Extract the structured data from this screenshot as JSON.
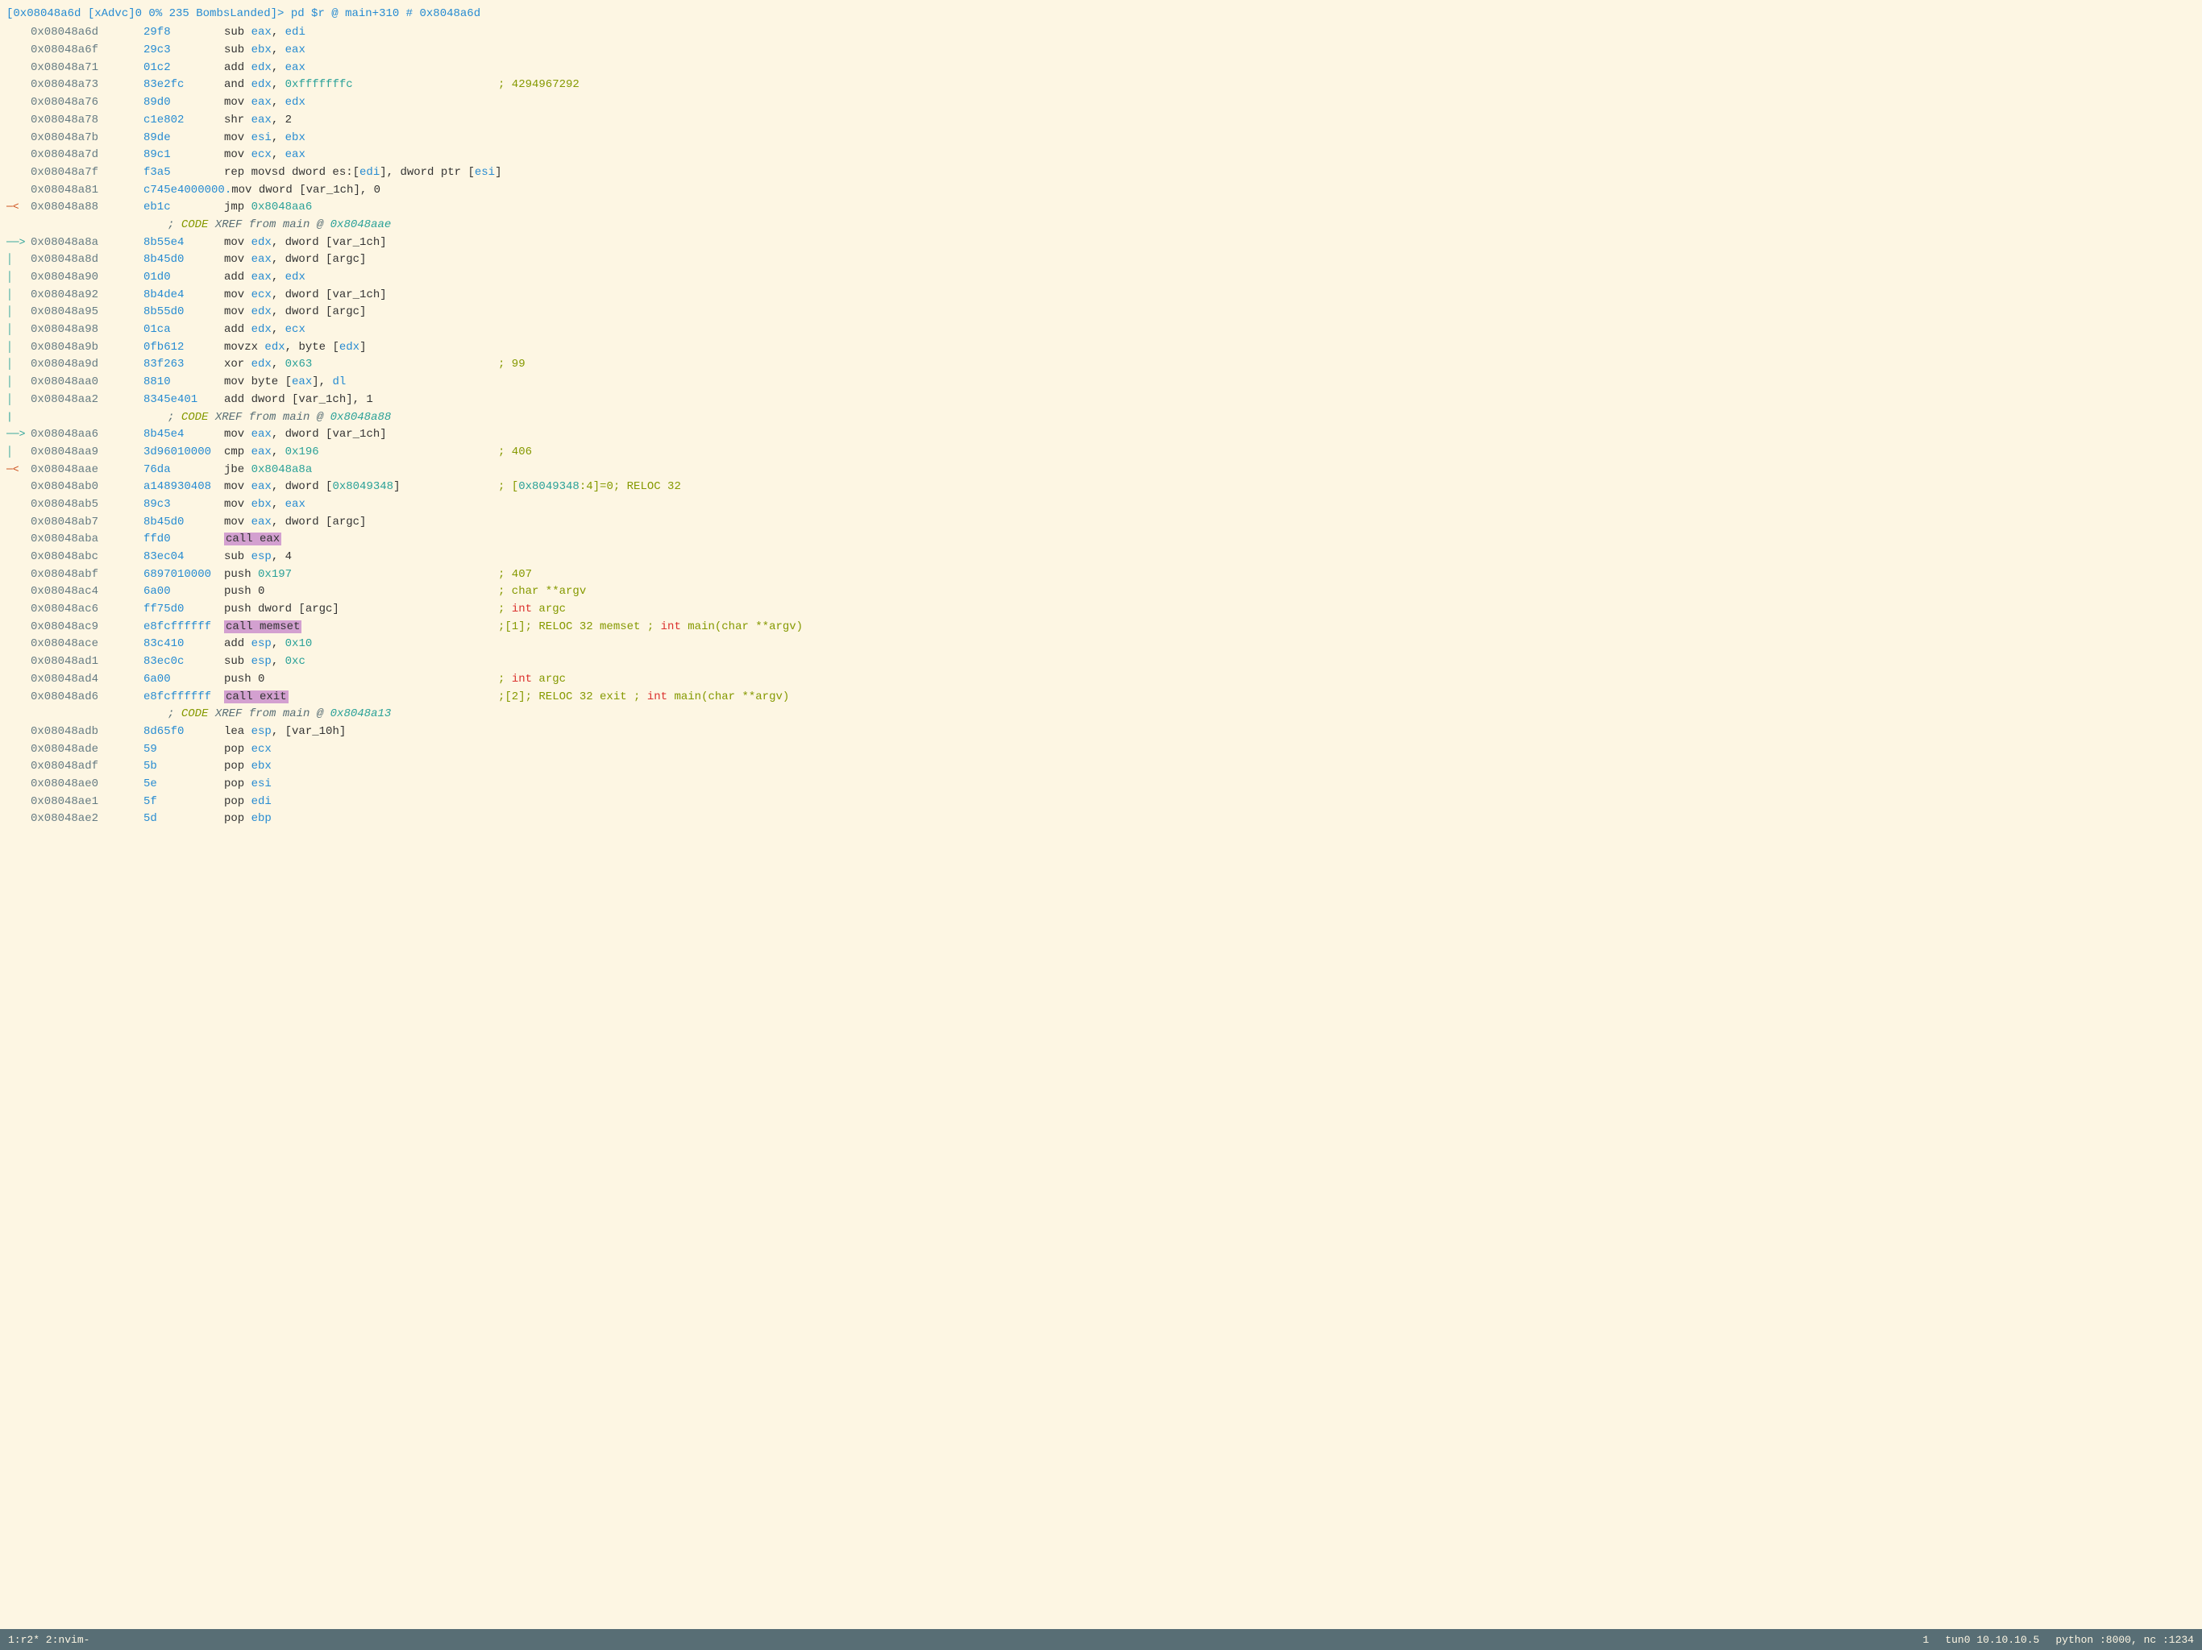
{
  "header": {
    "text": "[0x08048a6d  [xAdvc]0 0% 235 BombsLanded]> pd $r @ main+310 # 0x8048a6d"
  },
  "lines": [
    {
      "addr": "0x08048a6d",
      "bytes": "29f8",
      "mnemonic": "sub eax, edi",
      "comment": "",
      "arrow": "",
      "highlight": false,
      "ref": false
    },
    {
      "addr": "0x08048a6f",
      "bytes": "29c3",
      "mnemonic": "sub ebx, eax",
      "comment": "",
      "arrow": "",
      "highlight": false,
      "ref": false
    },
    {
      "addr": "0x08048a71",
      "bytes": "01c2",
      "mnemonic": "add edx, eax",
      "comment": "",
      "arrow": "",
      "highlight": false,
      "ref": false
    },
    {
      "addr": "0x08048a73",
      "bytes": "83e2fc",
      "mnemonic": "and edx, 0xfffffffc",
      "comment": "; 4294967292",
      "arrow": "",
      "highlight": false,
      "ref": false
    },
    {
      "addr": "0x08048a76",
      "bytes": "89d0",
      "mnemonic": "mov eax, edx",
      "comment": "",
      "arrow": "",
      "highlight": false,
      "ref": false
    },
    {
      "addr": "0x08048a78",
      "bytes": "c1e802",
      "mnemonic": "shr eax, 2",
      "comment": "",
      "arrow": "",
      "highlight": false,
      "ref": false
    },
    {
      "addr": "0x08048a7b",
      "bytes": "89de",
      "mnemonic": "mov esi, ebx",
      "comment": "",
      "arrow": "",
      "highlight": false,
      "ref": false
    },
    {
      "addr": "0x08048a7d",
      "bytes": "89c1",
      "mnemonic": "mov ecx, eax",
      "comment": "",
      "arrow": "",
      "highlight": false,
      "ref": false
    },
    {
      "addr": "0x08048a7f",
      "bytes": "f3a5",
      "mnemonic": "rep movsd dword es:[edi], dword ptr [esi]",
      "comment": "",
      "arrow": "",
      "highlight": false,
      "ref": false
    },
    {
      "addr": "0x08048a81",
      "bytes": "c745e4000000.",
      "mnemonic": "mov dword [var_1ch], 0",
      "comment": "",
      "arrow": "",
      "highlight": false,
      "ref": false
    },
    {
      "addr": "0x08048a88",
      "bytes": "eb1c",
      "mnemonic": "jmp 0x8048aa6",
      "comment": "",
      "arrow": "<",
      "highlight": false,
      "ref": false
    },
    {
      "addr": "",
      "bytes": "",
      "mnemonic": "; CODE XREF from main @ 0x8048aae",
      "comment": "",
      "arrow": "",
      "highlight": false,
      "ref": true
    },
    {
      "addr": "0x08048a8a",
      "bytes": "8b55e4",
      "mnemonic": "mov edx, dword [var_1ch]",
      "comment": "",
      "arrow": "->",
      "highlight": false,
      "ref": false
    },
    {
      "addr": "0x08048a8d",
      "bytes": "8b45d0",
      "mnemonic": "mov eax, dword [argc]",
      "comment": "",
      "arrow": "|",
      "highlight": false,
      "ref": false
    },
    {
      "addr": "0x08048a90",
      "bytes": "01d0",
      "mnemonic": "add eax, edx",
      "comment": "",
      "arrow": "|",
      "highlight": false,
      "ref": false
    },
    {
      "addr": "0x08048a92",
      "bytes": "8b4de4",
      "mnemonic": "mov ecx, dword [var_1ch]",
      "comment": "",
      "arrow": "|",
      "highlight": false,
      "ref": false
    },
    {
      "addr": "0x08048a95",
      "bytes": "8b55d0",
      "mnemonic": "mov edx, dword [argc]",
      "comment": "",
      "arrow": "|",
      "highlight": false,
      "ref": false
    },
    {
      "addr": "0x08048a98",
      "bytes": "01ca",
      "mnemonic": "add edx, ecx",
      "comment": "",
      "arrow": "|",
      "highlight": false,
      "ref": false
    },
    {
      "addr": "0x08048a9b",
      "bytes": "0fb612",
      "mnemonic": "movzx edx, byte [edx]",
      "comment": "",
      "arrow": "|",
      "highlight": false,
      "ref": false
    },
    {
      "addr": "0x08048a9d",
      "bytes": "83f263",
      "mnemonic": "xor edx, 0x63",
      "comment": "; 99",
      "arrow": "|",
      "highlight": false,
      "ref": false
    },
    {
      "addr": "0x08048aa0",
      "bytes": "8810",
      "mnemonic": "mov byte [eax], dl",
      "comment": "",
      "arrow": "|",
      "highlight": false,
      "ref": false
    },
    {
      "addr": "0x08048aa2",
      "bytes": "8345e401",
      "mnemonic": "add dword [var_1ch], 1",
      "comment": "",
      "arrow": "|",
      "highlight": false,
      "ref": false
    },
    {
      "addr": "",
      "bytes": "",
      "mnemonic": "; CODE XREF from main @ 0x8048a88",
      "comment": "",
      "arrow": "|",
      "highlight": false,
      "ref": true
    },
    {
      "addr": "0x08048aa6",
      "bytes": "8b45e4",
      "mnemonic": "mov eax, dword [var_1ch]",
      "comment": "",
      "arrow": "->",
      "highlight": false,
      "ref": false
    },
    {
      "addr": "0x08048aa9",
      "bytes": "3d96010000",
      "mnemonic": "cmp eax, 0x196",
      "comment": "; 406",
      "arrow": "|",
      "highlight": false,
      "ref": false
    },
    {
      "addr": "0x08048aae",
      "bytes": "76da",
      "mnemonic": "jbe 0x8048a8a",
      "comment": "",
      "arrow": "<",
      "highlight": false,
      "ref": false
    },
    {
      "addr": "0x08048ab0",
      "bytes": "a148930408",
      "mnemonic": "mov eax, dword [0x8049348]",
      "comment": "; [0x8049348:4]=0; RELOC 32",
      "arrow": "",
      "highlight": false,
      "ref": false
    },
    {
      "addr": "0x08048ab5",
      "bytes": "89c3",
      "mnemonic": "mov ebx, eax",
      "comment": "",
      "arrow": "",
      "highlight": false,
      "ref": false
    },
    {
      "addr": "0x08048ab7",
      "bytes": "8b45d0",
      "mnemonic": "mov eax, dword [argc]",
      "comment": "",
      "arrow": "",
      "highlight": false,
      "ref": false
    },
    {
      "addr": "0x08048aba",
      "bytes": "ffd0",
      "mnemonic_raw": "call eax",
      "comment": "",
      "arrow": "",
      "highlight": true,
      "ref": false
    },
    {
      "addr": "0x08048abc",
      "bytes": "83ec04",
      "mnemonic": "sub esp, 4",
      "comment": "",
      "arrow": "",
      "highlight": false,
      "ref": false
    },
    {
      "addr": "0x08048abf",
      "bytes": "6897010000",
      "mnemonic": "push 0x197",
      "comment": "; 407",
      "arrow": "",
      "highlight": false,
      "ref": false
    },
    {
      "addr": "0x08048ac4",
      "bytes": "6a00",
      "mnemonic": "push 0",
      "comment": "; char **argv",
      "arrow": "",
      "highlight": false,
      "ref": false
    },
    {
      "addr": "0x08048ac6",
      "bytes": "ff75d0",
      "mnemonic": "push dword [argc]",
      "comment": "; int argc",
      "arrow": "",
      "highlight": false,
      "ref": false
    },
    {
      "addr": "0x08048ac9",
      "bytes": "e8fcffffff",
      "mnemonic_raw": "call memset",
      "comment": ";[1]; RELOC 32 memset ; int main(char **argv)",
      "arrow": "",
      "highlight": true,
      "ref": false
    },
    {
      "addr": "0x08048ace",
      "bytes": "83c410",
      "mnemonic": "add esp, 0x10",
      "comment": "",
      "arrow": "",
      "highlight": false,
      "ref": false
    },
    {
      "addr": "0x08048ad1",
      "bytes": "83ec0c",
      "mnemonic": "sub esp, 0xc",
      "comment": "",
      "arrow": "",
      "highlight": false,
      "ref": false
    },
    {
      "addr": "0x08048ad4",
      "bytes": "6a00",
      "mnemonic": "push 0",
      "comment": "; int argc",
      "arrow": "",
      "highlight": false,
      "ref": false
    },
    {
      "addr": "0x08048ad6",
      "bytes": "e8fcffffff",
      "mnemonic_raw": "call exit",
      "comment": ";[2]; RELOC 32 exit ; int main(char **argv)",
      "arrow": "",
      "highlight": true,
      "ref": false
    },
    {
      "addr": "",
      "bytes": "",
      "mnemonic": "; CODE XREF from main @ 0x8048a13",
      "comment": "",
      "arrow": "",
      "highlight": false,
      "ref": true
    },
    {
      "addr": "0x08048adb",
      "bytes": "8d65f0",
      "mnemonic": "lea esp, [var_10h]",
      "comment": "",
      "arrow": "",
      "highlight": false,
      "ref": false
    },
    {
      "addr": "0x08048ade",
      "bytes": "59",
      "mnemonic": "pop ecx",
      "comment": "",
      "arrow": "",
      "highlight": false,
      "ref": false
    },
    {
      "addr": "0x08048adf",
      "bytes": "5b",
      "mnemonic": "pop ebx",
      "comment": "",
      "arrow": "",
      "highlight": false,
      "ref": false
    },
    {
      "addr": "0x08048ae0",
      "bytes": "5e",
      "mnemonic": "pop esi",
      "comment": "",
      "arrow": "",
      "highlight": false,
      "ref": false
    },
    {
      "addr": "0x08048ae1",
      "bytes": "5f",
      "mnemonic": "pop edi",
      "comment": "",
      "arrow": "",
      "highlight": false,
      "ref": false
    },
    {
      "addr": "0x08048ae2",
      "bytes": "5d",
      "mnemonic": "pop ebp",
      "comment": "",
      "arrow": "",
      "highlight": false,
      "ref": false
    }
  ],
  "status": {
    "left": "1:r2* 2:nvim-",
    "line_num": "1",
    "host": "tun0 10.10.10.5",
    "services": "python :8000, nc :1234"
  }
}
